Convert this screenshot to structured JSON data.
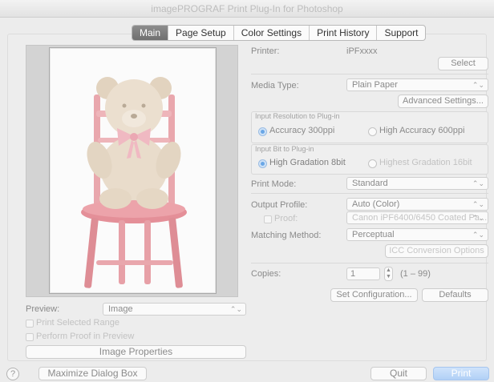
{
  "window": {
    "title": "imagePROGRAF Print Plug-In for Photoshop"
  },
  "tabs": [
    {
      "label": "Main",
      "active": true
    },
    {
      "label": "Page Setup",
      "active": false
    },
    {
      "label": "Color Settings",
      "active": false
    },
    {
      "label": "Print History",
      "active": false
    },
    {
      "label": "Support",
      "active": false
    }
  ],
  "left": {
    "preview_label": "Preview:",
    "preview_value": "Image",
    "print_selected_range": "Print Selected Range",
    "perform_proof": "Perform Proof in Preview",
    "image_properties": "Image Properties"
  },
  "right": {
    "printer_label": "Printer:",
    "printer_value": "iPFxxxx",
    "select_button": "Select",
    "media_type_label": "Media Type:",
    "media_type_value": "Plain Paper",
    "advanced_settings": "Advanced Settings...",
    "input_resolution_title": "Input Resolution to Plug-in",
    "accuracy_300": "Accuracy 300ppi",
    "accuracy_600": "High Accuracy 600ppi",
    "input_bit_title": "Input Bit to Plug-in",
    "gradation_8": "High Gradation 8bit",
    "gradation_16": "Highest Gradation 16bit",
    "print_mode_label": "Print Mode:",
    "print_mode_value": "Standard",
    "output_profile_label": "Output Profile:",
    "output_profile_value": "Auto (Color)",
    "proof_label": "Proof:",
    "proof_value": "Canon iPF6400/6450 Coated Pa...",
    "matching_method_label": "Matching Method:",
    "matching_method_value": "Perceptual",
    "icc_options": "ICC Conversion Options",
    "copies_label": "Copies:",
    "copies_value": "1",
    "copies_range": "(1 – 99)",
    "set_configuration": "Set Configuration...",
    "defaults": "Defaults"
  },
  "footer": {
    "help": "?",
    "maximize": "Maximize Dialog Box",
    "quit": "Quit",
    "print": "Print"
  },
  "icons": [
    "help-icon",
    "popup-arrow-icon",
    "stepper-icon",
    "radio-selected-icon"
  ],
  "colors": {
    "accent": "#6aa7e6",
    "primary_button": "#b1d0f6",
    "tab_active": "#7a7a7a"
  }
}
